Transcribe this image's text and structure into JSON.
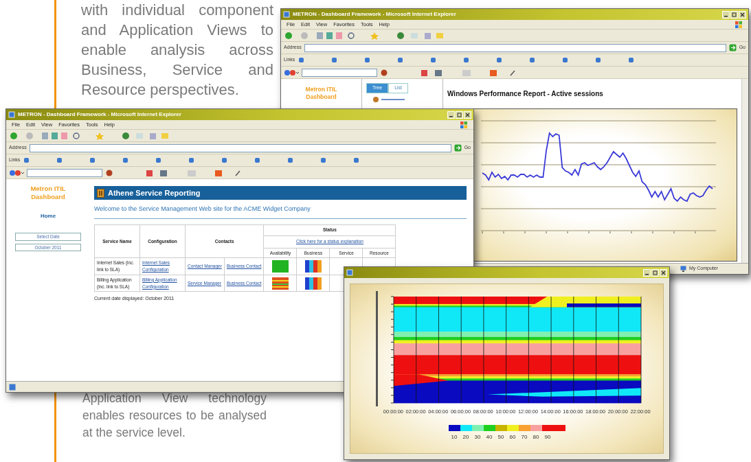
{
  "intro_text": "with individual component and Application Views to enable analysis across Business, Service and Resource perspectives.",
  "report_window": {
    "title": "METRON - Dashboard Framework - Microsoft Internet Explorer",
    "menu": [
      "File",
      "Edit",
      "View",
      "Favorites",
      "Tools",
      "Help"
    ],
    "address_label": "Address",
    "go_label": "Go",
    "links_label": "Links",
    "sidebar_title": "Metron ITIL Dashboard",
    "tree_tabs": [
      {
        "label": "Tree",
        "selected": true
      },
      {
        "label": "List",
        "selected": false
      }
    ],
    "report_title": "Windows Performance Report - Active sessions",
    "status_text": "My Computer"
  },
  "dashboard_window": {
    "title": "METRON - Dashboard Framework - Microsoft Internet Explorer",
    "menu": [
      "File",
      "Edit",
      "View",
      "Favorites",
      "Tools",
      "Help"
    ],
    "address_label": "Address",
    "go_label": "Go",
    "links_label": "Links",
    "sidebar_title": "Metron ITIL Dashboard",
    "home_link": "Home",
    "sidebar_buttons": [
      "Select Date",
      "October 2011"
    ],
    "banner_title": "Athene Service Reporting",
    "welcome_text": "Welcome to the Service Management Web site for the ACME Widget Company",
    "table": {
      "columns": [
        "Service Name",
        "Configuration",
        "Contacts",
        "Status"
      ],
      "status_link": "Click here for a status explanation",
      "status_columns": [
        "Availability",
        "Business",
        "Service",
        "Resource"
      ],
      "rows": [
        {
          "service": "Internet Sales (inc. link to SLA)",
          "configuration": "Internet Sales Configuration",
          "contact_1": "Contact Manager",
          "contact_2": "Business Contact",
          "availability": {
            "kind": "solid",
            "color": "#22b422"
          }
        },
        {
          "service": "Billing Application (inc. link to SLA)",
          "configuration": "Billing Application Configuration",
          "contact_1": "Service Manager",
          "contact_2": "Business Contact",
          "availability": {
            "kind": "striped",
            "color": "#e0501c"
          }
        }
      ]
    },
    "current_date": "Current date displayed: October 2011"
  },
  "contour_window": {
    "time_labels": [
      "00:00:00",
      "02:00:00",
      "04:00:00",
      "06:00:00",
      "08:00:00",
      "10:00:00",
      "12:00:00",
      "14:00:00",
      "16:00:00",
      "18:00:00",
      "20:00:00",
      "22:00:00"
    ],
    "legend_labels": [
      "10",
      "20",
      "30",
      "40",
      "50",
      "60",
      "70",
      "80",
      "90"
    ]
  },
  "caption_text": "Application View technology enables resources to be analysed at the service level."
}
